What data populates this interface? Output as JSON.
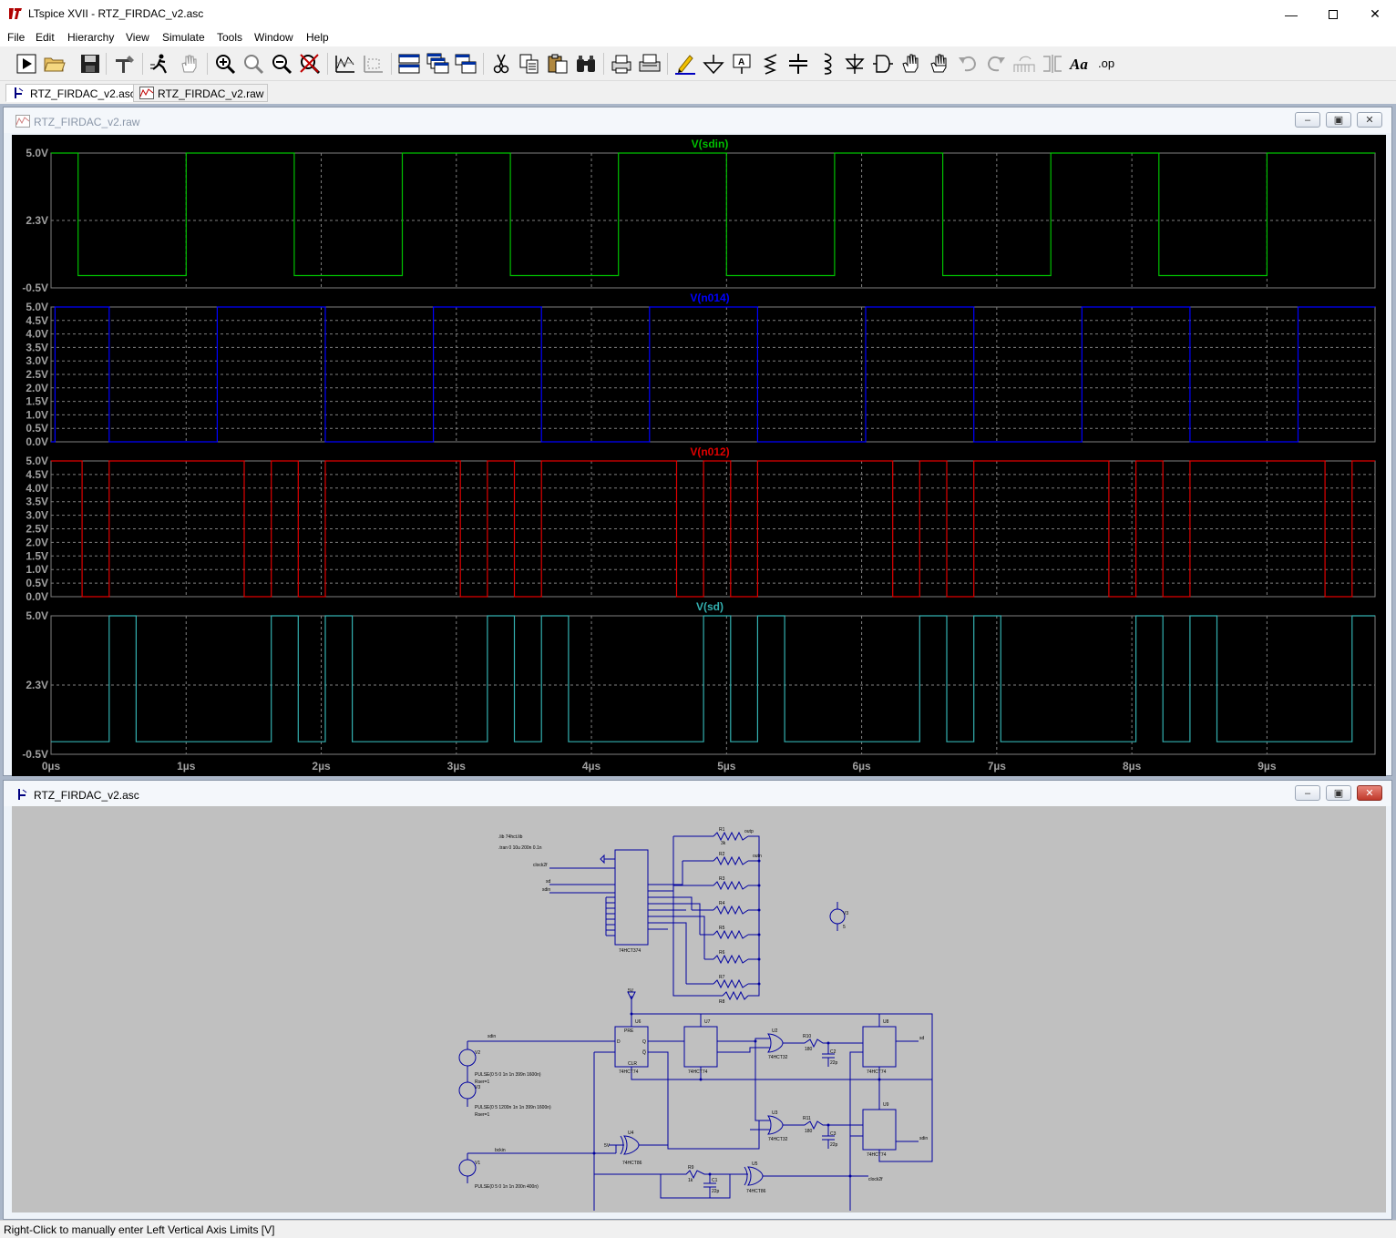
{
  "window": {
    "title": "LTspice XVII - RTZ_FIRDAC_v2.asc",
    "controls": [
      "minimize-icon",
      "maximize-icon",
      "close-icon"
    ]
  },
  "menu": [
    "File",
    "Edit",
    "Hierarchy",
    "View",
    "Simulate",
    "Tools",
    "Window",
    "Help"
  ],
  "toolbar": {
    "icons": [
      "run-icon",
      "open-icon",
      "save-icon",
      "control-panel-icon",
      "halt-icon",
      "pan-hand-icon",
      "zoom-in-icon",
      "zoom-fit-icon",
      "zoom-out-icon",
      "zoom-cancel-icon",
      "plot-settings-icon",
      "autoscale-icon",
      "tile-horizontal-icon",
      "cascade-icon",
      "tile-vertical-icon",
      "cut-icon",
      "copy-icon",
      "paste-icon",
      "find-icon",
      "print-preview-icon",
      "print-icon",
      "draw-wire-icon",
      "ground-icon",
      "label-net-icon",
      "resistor-icon",
      "capacitor-icon",
      "inductor-icon",
      "diode-icon",
      "component-icon",
      "move-icon",
      "drag-icon",
      "undo-icon",
      "redo-icon",
      "rotate-icon",
      "mirror-icon",
      "text-icon",
      "spice-directive-icon"
    ],
    "text_label": "Aa",
    "op_label": ".op"
  },
  "tabs": [
    {
      "label": "RTZ_FIRDAC_v2.asc",
      "icon": "schematic-icon",
      "active": true
    },
    {
      "label": "RTZ_FIRDAC_v2.raw",
      "icon": "waveform-icon",
      "active": false
    }
  ],
  "plot_window": {
    "title": "RTZ_FIRDAC_v2.raw"
  },
  "schematic_window": {
    "title": "RTZ_FIRDAC_v2.asc"
  },
  "chart_data": {
    "type": "line",
    "xlabel": "",
    "xlim": [
      0,
      9.8
    ],
    "x_ticks": [
      "0µs",
      "1µs",
      "2µs",
      "3µs",
      "4µs",
      "5µs",
      "6µs",
      "7µs",
      "8µs",
      "9µs"
    ],
    "grid": true,
    "panes": [
      {
        "name": "V(sdin)",
        "color": "#00c000",
        "ticks": [
          "5.0V",
          "2.3V",
          "-0.5V"
        ],
        "ylim": [
          -0.5,
          5.0
        ],
        "y_low": 0,
        "y_high": 5,
        "x": [
          0,
          0.2,
          0.2,
          1.0,
          1.0,
          1.8,
          1.8,
          2.6,
          2.6,
          3.4,
          3.4,
          4.2,
          4.2,
          5.0,
          5.0,
          5.8,
          5.8,
          6.6,
          6.6,
          7.4,
          7.4,
          8.2,
          8.2,
          9.0,
          9.0,
          9.8
        ],
        "y": [
          5,
          5,
          0,
          0,
          5,
          5,
          0,
          0,
          5,
          5,
          0,
          0,
          5,
          5,
          0,
          0,
          5,
          5,
          0,
          0,
          5,
          5,
          0,
          0,
          5,
          5
        ]
      },
      {
        "name": "V(n014)",
        "color": "#0000ff",
        "ticks": [
          "5.0V",
          "4.5V",
          "4.0V",
          "3.5V",
          "3.0V",
          "2.5V",
          "2.0V",
          "1.5V",
          "1.0V",
          "0.5V",
          "0.0V"
        ],
        "ylim": [
          0,
          5.0
        ],
        "y_low": 0,
        "y_high": 5,
        "x": [
          0,
          0.03,
          0.03,
          0.43,
          0.43,
          1.23,
          1.23,
          2.03,
          2.03,
          2.83,
          2.83,
          3.63,
          3.63,
          4.43,
          4.43,
          5.23,
          5.23,
          6.03,
          6.03,
          6.83,
          6.83,
          7.63,
          7.63,
          8.43,
          8.43,
          9.23,
          9.23,
          9.8
        ],
        "y": [
          0,
          0,
          5,
          5,
          0,
          0,
          5,
          5,
          0,
          0,
          5,
          5,
          0,
          0,
          5,
          5,
          0,
          0,
          5,
          5,
          0,
          0,
          5,
          5,
          0,
          0,
          5,
          5
        ]
      },
      {
        "name": "V(n012)",
        "color": "#e00000",
        "ticks": [
          "5.0V",
          "4.5V",
          "4.0V",
          "3.5V",
          "3.0V",
          "2.5V",
          "2.0V",
          "1.5V",
          "1.0V",
          "0.5V",
          "0.0V"
        ],
        "ylim": [
          0,
          5.0
        ],
        "y_low": 0,
        "y_high": 5,
        "x": [
          0,
          0.23,
          0.23,
          0.43,
          0.43,
          1.43,
          1.43,
          1.63,
          1.63,
          1.83,
          1.83,
          2.03,
          2.03,
          3.03,
          3.03,
          3.23,
          3.23,
          3.43,
          3.43,
          3.63,
          3.63,
          4.63,
          4.63,
          4.83,
          4.83,
          5.03,
          5.03,
          5.23,
          5.23,
          6.23,
          6.23,
          6.43,
          6.43,
          6.63,
          6.63,
          6.83,
          6.83,
          7.83,
          7.83,
          8.03,
          8.03,
          8.23,
          8.23,
          8.43,
          8.43,
          9.43,
          9.43,
          9.63,
          9.63,
          9.8
        ],
        "y": [
          5,
          5,
          0,
          0,
          5,
          5,
          0,
          0,
          5,
          5,
          0,
          0,
          5,
          5,
          0,
          0,
          5,
          5,
          0,
          0,
          5,
          5,
          0,
          0,
          5,
          5,
          0,
          0,
          5,
          5,
          0,
          0,
          5,
          5,
          0,
          0,
          5,
          5,
          0,
          0,
          5,
          5,
          0,
          0,
          5,
          5,
          0,
          0,
          5,
          5
        ]
      },
      {
        "name": "V(sd)",
        "color": "#33b0b0",
        "ticks": [
          "5.0V",
          "2.3V",
          "-0.5V"
        ],
        "ylim": [
          -0.5,
          5.0
        ],
        "y_low": 0,
        "y_high": 5,
        "x": [
          0,
          0.43,
          0.43,
          0.63,
          0.63,
          1.63,
          1.63,
          1.83,
          1.83,
          2.03,
          2.03,
          2.23,
          2.23,
          3.23,
          3.23,
          3.43,
          3.43,
          3.63,
          3.63,
          3.83,
          3.83,
          4.83,
          4.83,
          5.03,
          5.03,
          5.23,
          5.23,
          5.43,
          5.43,
          6.43,
          6.43,
          6.63,
          6.63,
          6.83,
          6.83,
          7.03,
          7.03,
          8.03,
          8.03,
          8.23,
          8.23,
          8.43,
          8.43,
          8.63,
          8.63,
          9.63,
          9.63,
          9.8
        ],
        "y": [
          0,
          0,
          5,
          5,
          0,
          0,
          5,
          5,
          0,
          0,
          5,
          5,
          0,
          0,
          5,
          5,
          0,
          0,
          5,
          5,
          0,
          0,
          5,
          5,
          0,
          0,
          5,
          5,
          0,
          0,
          5,
          5,
          0,
          0,
          5,
          5,
          0,
          0,
          5,
          5,
          0,
          0,
          5,
          5,
          0,
          0,
          5,
          5
        ]
      }
    ]
  },
  "schematic": {
    "directives": [
      ".lib 74hct.lib",
      ".tran 0 10u 200n 0.1n"
    ],
    "resistors": [
      "R1",
      "R2",
      "R3",
      "R4",
      "R5",
      "R6",
      "R7",
      "R8"
    ],
    "resistor_value": "3k",
    "net_outp": "outp",
    "net_outn": "outn",
    "ic_374": "74HCT374",
    "ic_74_u6": "74HCT74",
    "ic_74_u7": "74HCT74",
    "ic_74_u8": "74HCT74",
    "ic_74_u9": "74HCT74",
    "ic_or_u2": "74HCT32",
    "ic_or_u3": "74HCT32",
    "ic_xor_u4": "74HCT86",
    "ic_xor_u5": "74HCT86",
    "labels": {
      "clock2f": "clock2f",
      "sd": "sd",
      "sdin": "sdin",
      "bckin": "bckin",
      "5v": "5V",
      "u6": "U6",
      "u7": "U7",
      "u8": "U8",
      "u9": "U9",
      "u2": "U2",
      "u3": "U3",
      "u4": "U4",
      "u5": "U5",
      "v1": "V1",
      "v2": "V2",
      "v3": "V3",
      "vsup": "V3",
      "r10": "R10",
      "r11": "R11",
      "r9": "R9",
      "c1": "C1",
      "c2": "C2",
      "c3": "C3",
      "r10_val": "180",
      "r11_val": "180",
      "r9_val": "1k",
      "c_val": "22p",
      "pre": "PRE",
      "clr": "CLR",
      "d": "D",
      "q": "Q",
      "qn": "Q̅",
      "sd_out": "sd",
      "sdin_out": "sdin",
      "clock2f_out": "clock2f"
    },
    "v2_spec": "PULSE(0 5 0 1n 1n 399n 1600n)",
    "v2_rser": "Rser=1",
    "v3_spec": "PULSE(0 5 1200n 1n 1n 399n 1600n)",
    "v3_rser": "Rser=1",
    "v1_spec": "PULSE(0 5 0 1n 1n 200n 400n)",
    "vsup_value": "5"
  },
  "status": "Right-Click to manually enter Left Vertical Axis Limits [V]",
  "colors": {
    "plot_bg": "#000000",
    "grid": "#7f7f7f",
    "schematic_bg": "#c0c0c0",
    "wire": "#0000a0",
    "mdi_bg": "#aab6c8"
  }
}
